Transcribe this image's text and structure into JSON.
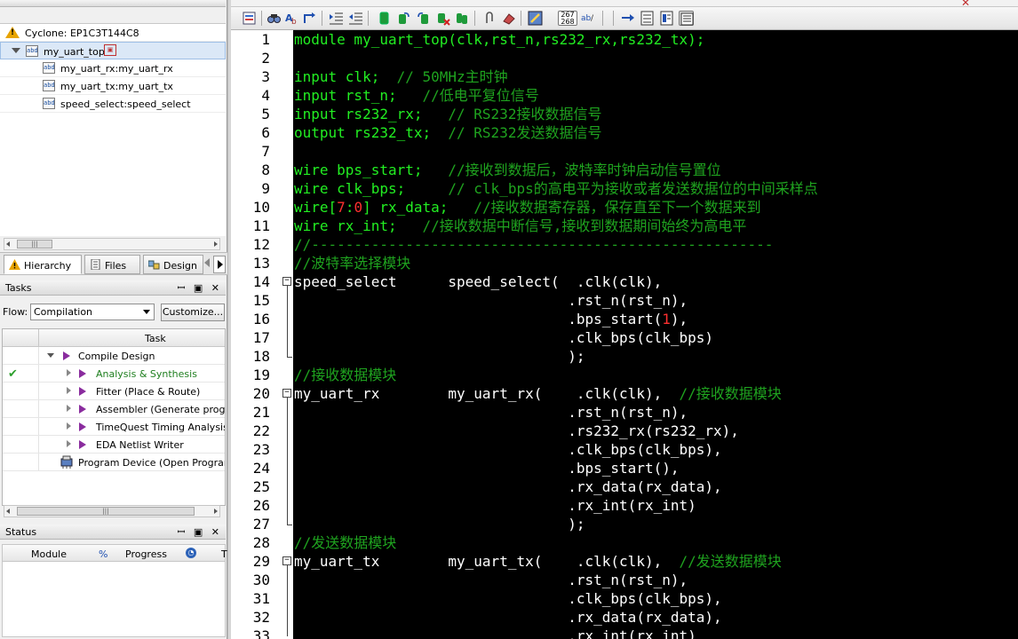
{
  "project": {
    "device": "Cyclone: EP1C3T144C8",
    "top": "my_uart_top",
    "children": [
      "my_uart_rx:my_uart_rx",
      "my_uart_tx:my_uart_tx",
      "speed_select:speed_select"
    ]
  },
  "nav_tabs": [
    {
      "label": "Hierarchy",
      "icon": "hierarchy-icon"
    },
    {
      "label": "Files",
      "icon": "files-icon"
    },
    {
      "label": "Design",
      "icon": "design-icon"
    }
  ],
  "tasks": {
    "title": "Tasks",
    "flow_label": "Flow:",
    "flow_value": "Compilation",
    "customize_label": "Customize...",
    "column_task": "Task",
    "rows": [
      {
        "label": "Compile Design",
        "done": false
      },
      {
        "label": "Analysis & Synthesis",
        "done": true
      },
      {
        "label": "Fitter (Place & Route)",
        "done": false
      },
      {
        "label": "Assembler (Generate programming files)",
        "done": false
      },
      {
        "label": "TimeQuest Timing Analysis",
        "done": false
      },
      {
        "label": "EDA Netlist Writer",
        "done": false
      },
      {
        "label": "Program Device (Open Programmer)",
        "done": false
      }
    ]
  },
  "status": {
    "title": "Status",
    "col_module": "Module",
    "col_percent": "%",
    "col_progress": "Progress",
    "col_t": "T"
  },
  "editor": {
    "line_count_badge": "267 268",
    "line_numbers": [
      "1",
      "2",
      "3",
      "4",
      "5",
      "6",
      "7",
      "8",
      "9",
      "10",
      "11",
      "12",
      "13",
      "14",
      "15",
      "16",
      "17",
      "18",
      "19",
      "20",
      "21",
      "22",
      "23",
      "24",
      "25",
      "26",
      "27",
      "28",
      "29",
      "30",
      "31",
      "32",
      "33"
    ],
    "lines": [
      [
        {
          "t": "module my_uart_top(clk,rst_n,rs232_rx,rs232_tx);",
          "c": "kw"
        }
      ],
      [],
      [
        {
          "t": "input clk;  ",
          "c": "kw"
        },
        {
          "t": "// 50MHz主时钟",
          "c": "cm"
        }
      ],
      [
        {
          "t": "input rst_n;   ",
          "c": "kw"
        },
        {
          "t": "//低电平复位信号",
          "c": "cm"
        }
      ],
      [
        {
          "t": "input rs232_rx;   ",
          "c": "kw"
        },
        {
          "t": "// RS232接收数据信号",
          "c": "cm"
        }
      ],
      [
        {
          "t": "output rs232_tx;  ",
          "c": "kw"
        },
        {
          "t": "// RS232发送数据信号",
          "c": "cm"
        }
      ],
      [],
      [
        {
          "t": "wire bps_start;   ",
          "c": "kw"
        },
        {
          "t": "//接收到数据后，波特率时钟启动信号置位",
          "c": "cm"
        }
      ],
      [
        {
          "t": "wire clk_bps;     ",
          "c": "kw"
        },
        {
          "t": "// clk_bps的高电平为接收或者发送数据位的中间采样点",
          "c": "cm"
        }
      ],
      [
        {
          "t": "wire[",
          "c": "kw"
        },
        {
          "t": "7",
          "c": "num"
        },
        {
          "t": ":",
          "c": "kw"
        },
        {
          "t": "0",
          "c": "num"
        },
        {
          "t": "] rx_data;   ",
          "c": "kw"
        },
        {
          "t": "//接收数据寄存器，保存直至下一个数据来到",
          "c": "cm"
        }
      ],
      [
        {
          "t": "wire rx_int;   ",
          "c": "kw"
        },
        {
          "t": "//接收数据中断信号,接收到数据期间始终为高电平",
          "c": "cm"
        }
      ],
      [
        {
          "t": "//------------------------------------------------------",
          "c": "cm"
        }
      ],
      [
        {
          "t": "//波特率选择模块",
          "c": "cm"
        }
      ],
      [
        {
          "t": "speed_select      speed_select(  .clk(clk),",
          "c": ""
        }
      ],
      [
        {
          "t": "                                .rst_n(rst_n),",
          "c": ""
        }
      ],
      [
        {
          "t": "                                .bps_start(",
          "c": ""
        },
        {
          "t": "1",
          "c": "num"
        },
        {
          "t": "),",
          "c": ""
        }
      ],
      [
        {
          "t": "                                .clk_bps(clk_bps)",
          "c": ""
        }
      ],
      [
        {
          "t": "                                );",
          "c": ""
        }
      ],
      [
        {
          "t": "//接收数据模块",
          "c": "cm"
        }
      ],
      [
        {
          "t": "my_uart_rx        my_uart_rx(    .clk(clk),  ",
          "c": ""
        },
        {
          "t": "//接收数据模块",
          "c": "cm"
        }
      ],
      [
        {
          "t": "                                .rst_n(rst_n),",
          "c": ""
        }
      ],
      [
        {
          "t": "                                .rs232_rx(rs232_rx),",
          "c": ""
        }
      ],
      [
        {
          "t": "                                .clk_bps(clk_bps),",
          "c": ""
        }
      ],
      [
        {
          "t": "                                .bps_start(),",
          "c": ""
        }
      ],
      [
        {
          "t": "                                .rx_data(rx_data),",
          "c": ""
        }
      ],
      [
        {
          "t": "                                .rx_int(rx_int)",
          "c": ""
        }
      ],
      [
        {
          "t": "                                );",
          "c": ""
        }
      ],
      [
        {
          "t": "//发送数据模块",
          "c": "cm"
        }
      ],
      [
        {
          "t": "my_uart_tx        my_uart_tx(    .clk(clk),  ",
          "c": ""
        },
        {
          "t": "//发送数据模块",
          "c": "cm"
        }
      ],
      [
        {
          "t": "                                .rst_n(rst_n),",
          "c": ""
        }
      ],
      [
        {
          "t": "                                .clk_bps(clk_bps),",
          "c": ""
        }
      ],
      [
        {
          "t": "                                .rx_data(rx_data),",
          "c": ""
        }
      ],
      [
        {
          "t": "                                .rx_int(rx_int)",
          "c": ""
        }
      ]
    ]
  }
}
